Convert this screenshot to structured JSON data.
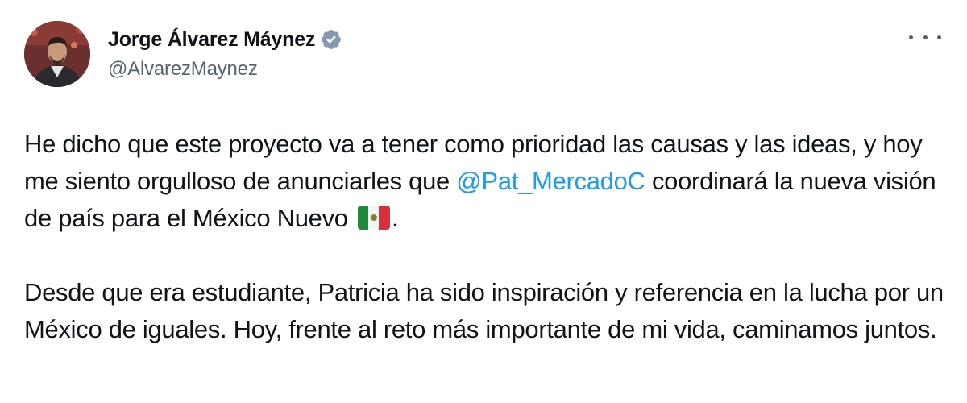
{
  "author": {
    "display_name": "Jorge Álvarez Máynez",
    "handle": "@AlvarezMaynez",
    "verified": true,
    "verified_color": "#829aab"
  },
  "menu": {
    "icon": "more-horizontal-icon"
  },
  "tweet": {
    "p1_before": "He dicho que este proyecto va a tener como prioridad las causas y las ideas, y hoy me siento orgulloso de anunciarles que ",
    "mention": "@Pat_MercadoC",
    "p1_after": " coordinará la nueva visión de país para el México Nuevo ",
    "flag_icon": "mexico-flag-emoji",
    "p1_end": ".",
    "p2": "Desde que era estudiante, Patricia ha sido inspiración y referencia en la lucha por un México de iguales. Hoy, frente al reto más importante de mi vida, caminamos juntos."
  },
  "colors": {
    "text": "#0f1419",
    "secondary": "#536471",
    "link": "#1d9bf0"
  }
}
